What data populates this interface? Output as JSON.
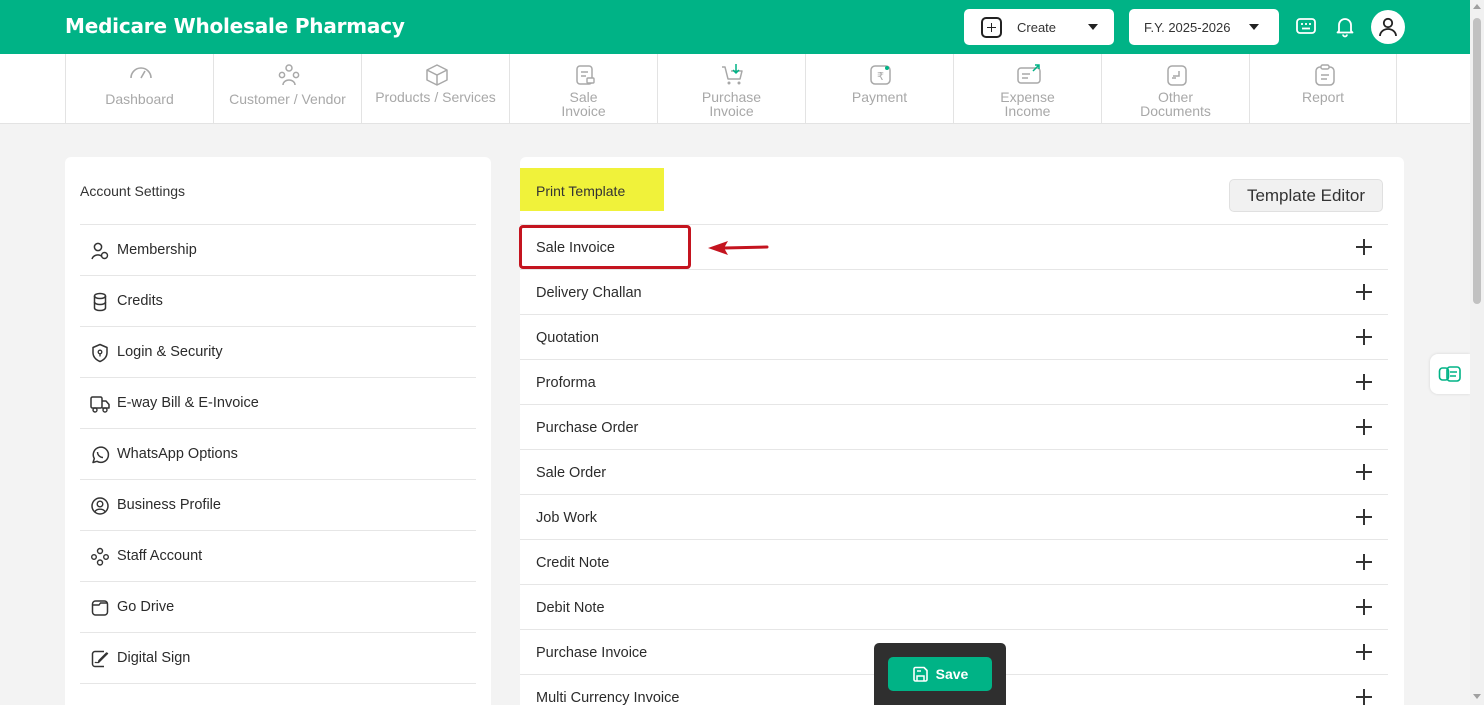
{
  "header": {
    "app_title": "Medicare Wholesale Pharmacy",
    "create_label": "Create",
    "fy_label": "F.Y. 2025-2026"
  },
  "nav": {
    "items": [
      {
        "line1": "Dashboard",
        "line2": "",
        "icon": "gauge-icon"
      },
      {
        "line1": "Customer / Vendor",
        "line2": "",
        "icon": "users-icon"
      },
      {
        "line1": "Products / Services",
        "line2": "",
        "icon": "box-icon"
      },
      {
        "line1": "Sale",
        "line2": "Invoice",
        "icon": "sale-invoice-icon"
      },
      {
        "line1": "Purchase",
        "line2": "Invoice",
        "icon": "cart-icon"
      },
      {
        "line1": "Payment",
        "line2": "",
        "icon": "rupee-icon"
      },
      {
        "line1": "Expense",
        "line2": "Income",
        "icon": "expense-icon"
      },
      {
        "line1": "Other",
        "line2": "Documents",
        "icon": "document-icon"
      },
      {
        "line1": "Report",
        "line2": "",
        "icon": "clipboard-icon"
      }
    ]
  },
  "account_settings": {
    "heading": "Account Settings",
    "items": [
      {
        "label": "Membership",
        "icon": "membership-icon"
      },
      {
        "label": "Credits",
        "icon": "coins-icon"
      },
      {
        "label": "Login & Security",
        "icon": "shield-icon"
      },
      {
        "label": "E-way Bill & E-Invoice",
        "icon": "truck-icon"
      },
      {
        "label": "WhatsApp Options",
        "icon": "whatsapp-icon"
      },
      {
        "label": "Business Profile",
        "icon": "user-circle-icon"
      },
      {
        "label": "Staff Account",
        "icon": "staff-icon"
      },
      {
        "label": "Go Drive",
        "icon": "folder-icon"
      },
      {
        "label": "Digital Sign",
        "icon": "sign-icon"
      }
    ]
  },
  "print_template": {
    "title": "Print Template",
    "editor_button": "Template Editor",
    "rows": [
      "Sale Invoice",
      "Delivery Challan",
      "Quotation",
      "Proforma",
      "Purchase Order",
      "Sale Order",
      "Job Work",
      "Credit Note",
      "Debit Note",
      "Purchase Invoice",
      "Multi Currency Invoice"
    ]
  },
  "save": {
    "label": "Save"
  },
  "colors": {
    "brand": "#00b386",
    "highlight": "#f0f23a",
    "annotation": "#c4141f"
  }
}
